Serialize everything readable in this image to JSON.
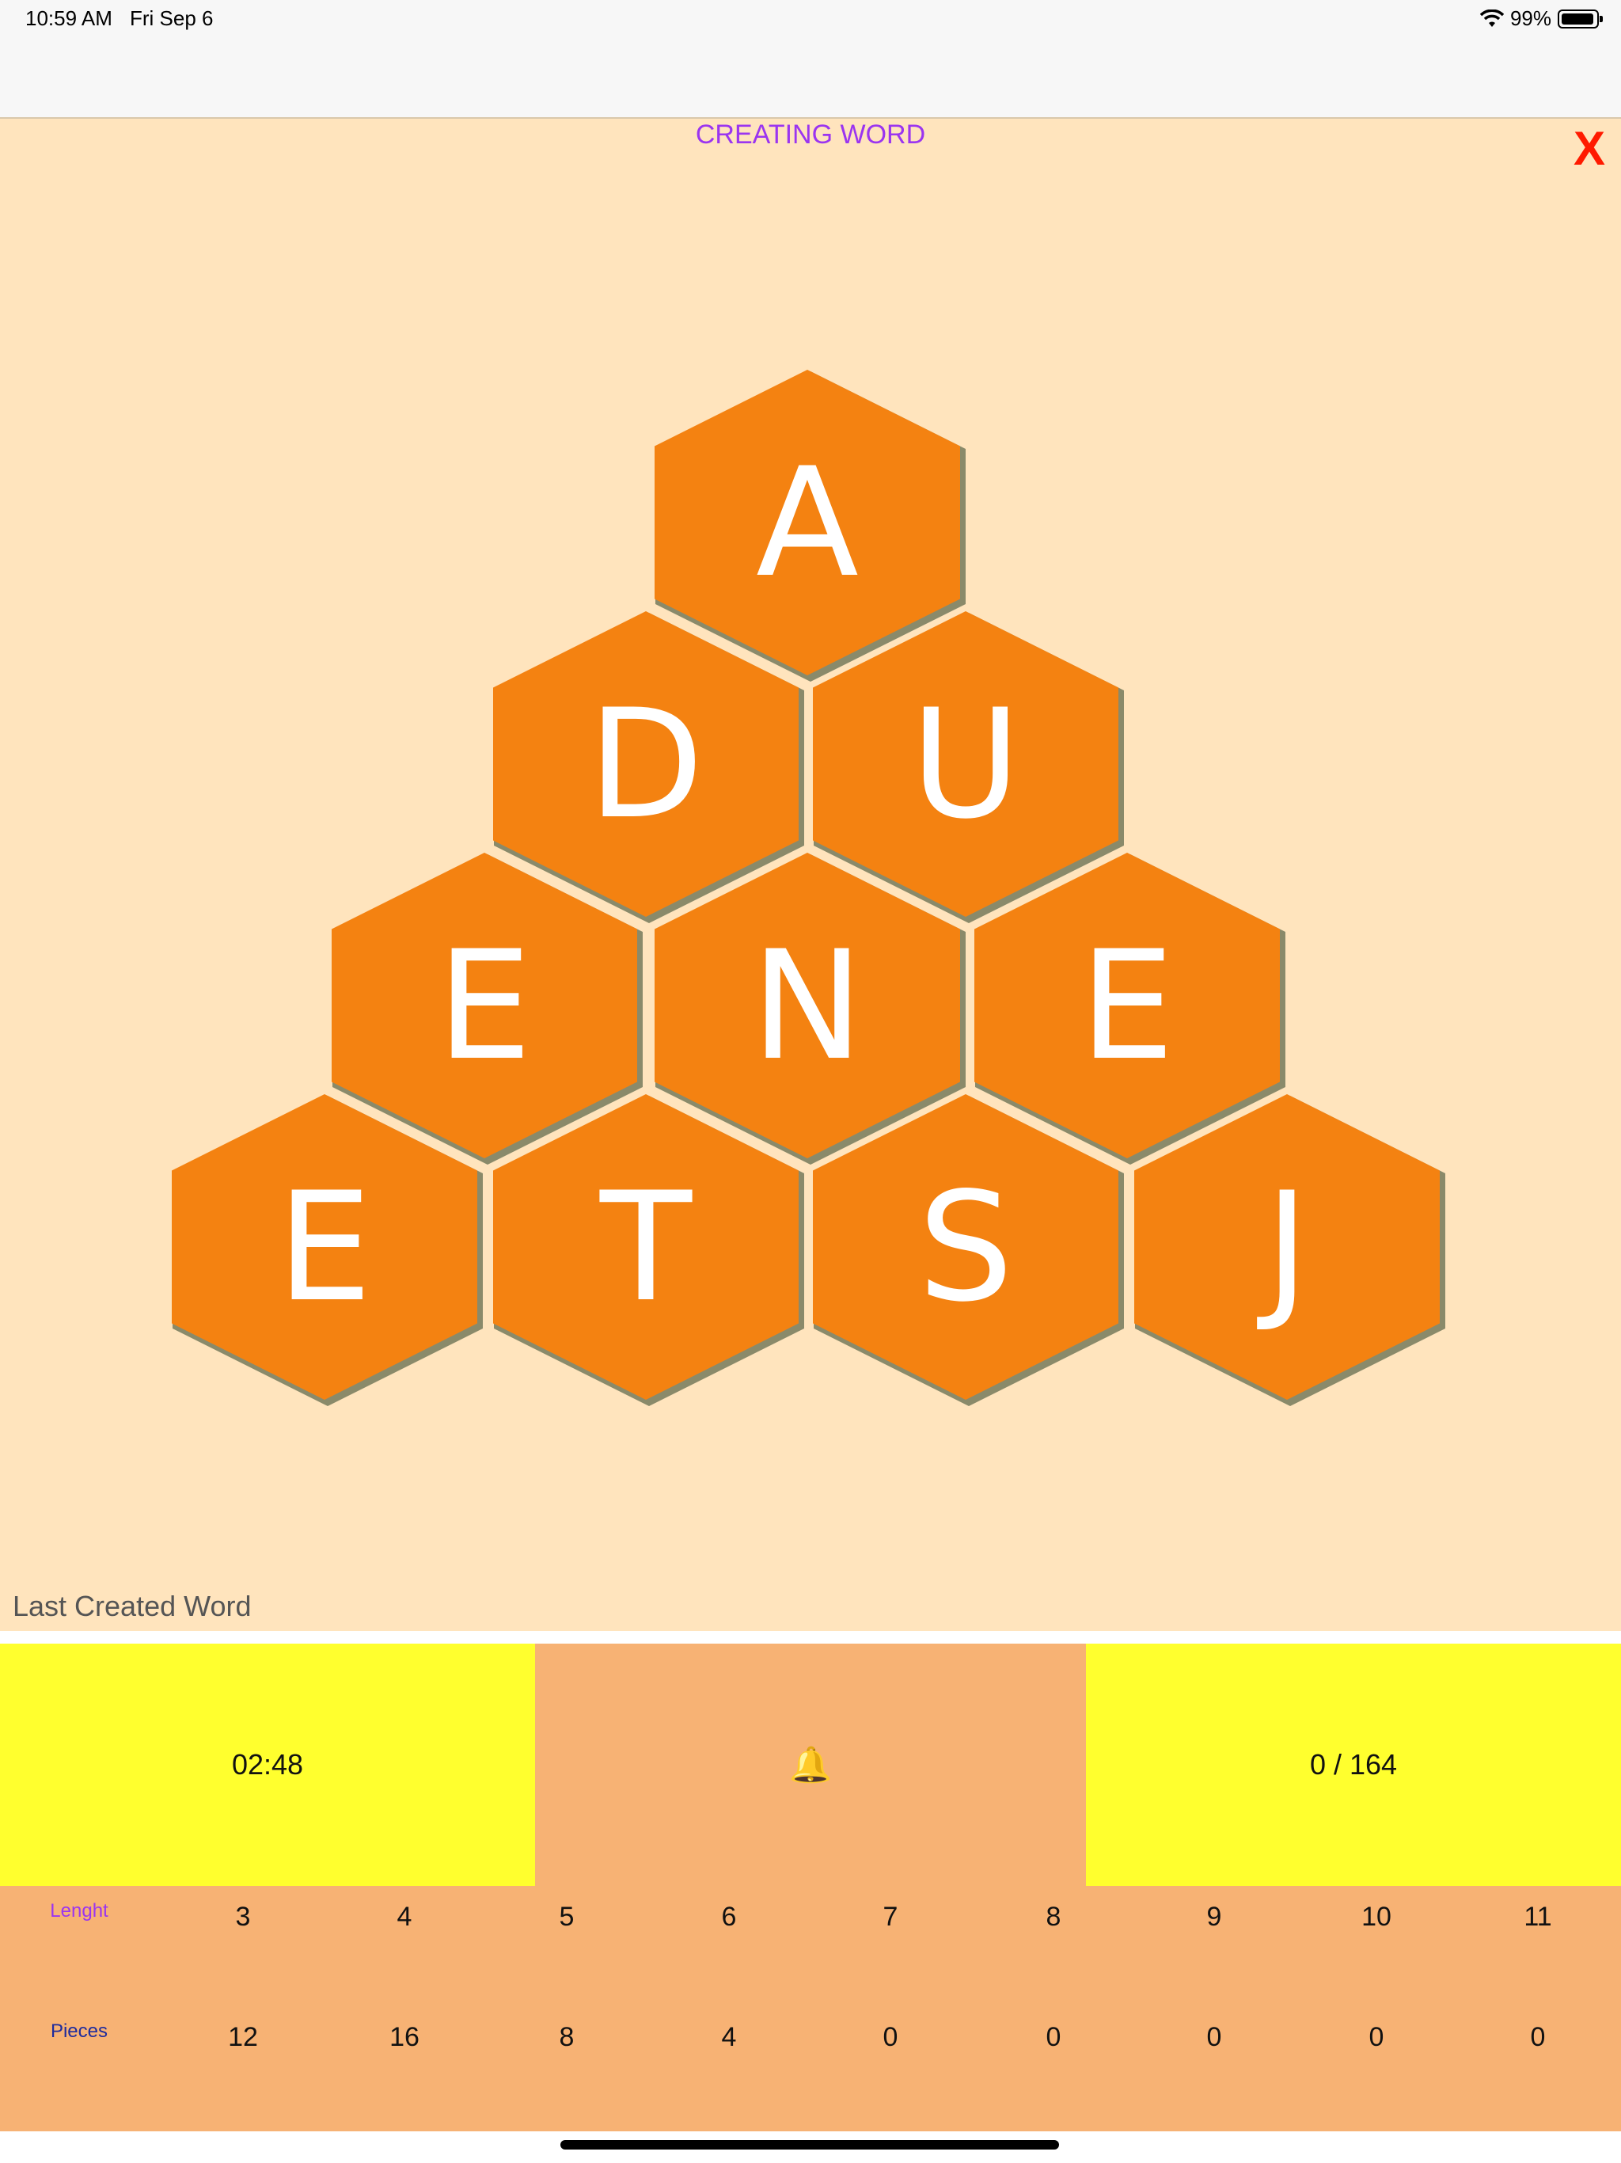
{
  "status_bar": {
    "time": "10:59 AM",
    "date": "Fri Sep 6",
    "battery": "99%",
    "battery_level": 0.99,
    "wifi_icon": "wifi-icon"
  },
  "game": {
    "title": "CREATING WORD",
    "close_label": "X",
    "last_word_label": "Last Created Word",
    "tile_color": "#f48211",
    "board_color": "#ffe4bd",
    "tiles": [
      {
        "letter": "A"
      },
      {
        "letter": "D"
      },
      {
        "letter": "U"
      },
      {
        "letter": "E"
      },
      {
        "letter": "N"
      },
      {
        "letter": "E"
      },
      {
        "letter": "E"
      },
      {
        "letter": "T"
      },
      {
        "letter": "S"
      },
      {
        "letter": "J"
      }
    ]
  },
  "info": {
    "timer": "02:48",
    "bell_icon": "bell-icon",
    "bell_glyph": "🔔",
    "score": "0 / 164"
  },
  "stats": {
    "length_label": "Lenght",
    "pieces_label": "Pieces",
    "lengths": [
      "3",
      "4",
      "5",
      "6",
      "7",
      "8",
      "9",
      "10",
      "11"
    ],
    "pieces": [
      "12",
      "16",
      "8",
      "4",
      "0",
      "0",
      "0",
      "0",
      "0"
    ]
  }
}
